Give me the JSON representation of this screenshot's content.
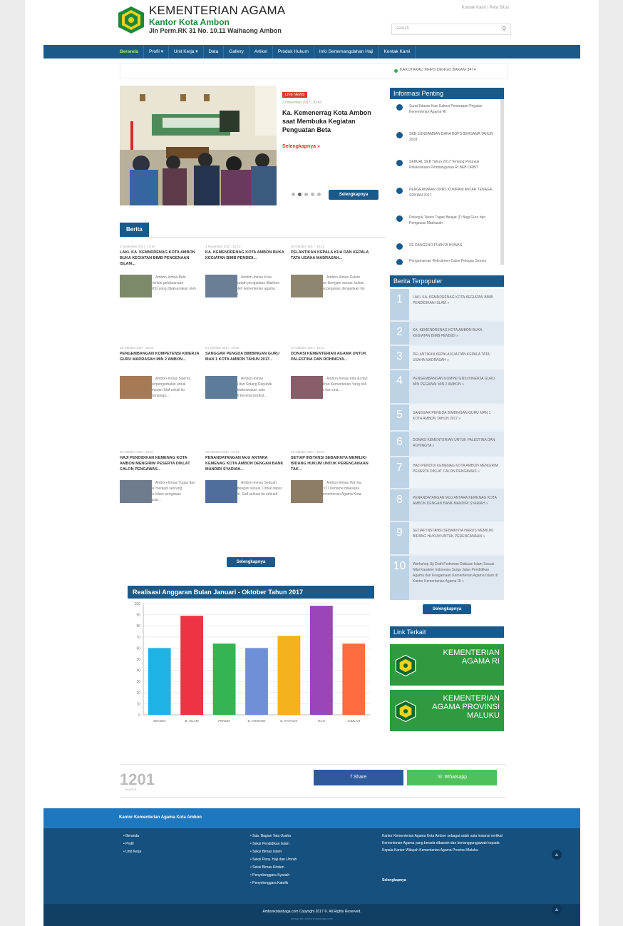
{
  "header": {
    "title": "KEMENTERIAN AGAMA",
    "subtitle": "Kantor Kota Ambon",
    "address": "Jln Perm.RK 31 No. 10.11 Waihaong Ambon",
    "top_links": "Kontak Kami | Peta Situs",
    "search_placeholder": "search"
  },
  "nav": {
    "items": [
      "Beranda",
      "Profil",
      "Unit Kerja",
      "Data",
      "Gallery",
      "Artikel",
      "Produk Hukum",
      "Info Sertemangdahan Haji",
      "Kontak Kami"
    ]
  },
  "ticker": {
    "text": "KAKUTAKAU MHPS DENGO BAKAM 3474"
  },
  "slider": {
    "tag": "LIVE NEWS",
    "date": "2 November 2017, 10:43",
    "title": "Ka. Kemenerrag Kota Ambon saat Membuka Kegiatan Penguatan Beta",
    "more": "Selengkapnya »",
    "button": "Selengkapnya"
  },
  "info_penting": {
    "title": "Informasi Penting",
    "items": [
      "Surat Edaran Kasi Kakesi Penerapan Pegalan Kementerian Agama RI",
      "SEB SUNGAMBAN DANA BOPS BERSAMA TAHUN 2018",
      "SEBUAL SEB Tahun 2017 Tentang Petunjuk Pelaksanaan Pembangunan RI BEB ORBIT",
      "PENGERIMAAN OPRS KOMPANI ANTAR TENAGA SOKIAN 2017",
      "Petunjuk Teknis Tugas Belajar (D Bagi Guru dan Pengawas Madrasah",
      "SE DANGENO PUANTA HUWAS",
      "Pengumuman Rekrutmen Calon Petugas Sensor CPNS di TPPU Lain"
    ]
  },
  "berita": {
    "title": "Berita",
    "items": [
      {
        "date": "2 November 2017, 10:40",
        "headline": "LAKL KA. KEMNDRENAG KOTA AMBON BUKA KEGIATAN BIMB PENGENAAN ISLAM...",
        "excerpt": "Ambon-Inmas Bidn Ambon telah secara terlalu pelaksanaan pendidikan Islam (PAIS) yang dilaksanakan oleh bidang..."
      },
      {
        "date": "1 November 2017, 10:12",
        "headline": "KA. KEMENDRENAG KOTA AMBON BUKA KEGIATAN BIMB PENDIDI...",
        "excerpt": "Ambon-Inmas Kota Moktim, Kampaken sudah pengadaan dilahkan yang dilaksanakan oleh kementerian agama yang berlanjut setiah..."
      },
      {
        "date": "30 Oktober 2017, 16:13",
        "headline": "PELANTIKAN KEPALA KUA DAN KEPALA TATA USAHA MADRASAH...",
        "excerpt": "Ambon-Inmas Dalam Kosenan pemanfaatan kinerjam sesuai, bukan magam ketiga dirawai pegawai, dengankan list yang telah..."
      },
      {
        "date": "26 Oktober 2017, 08:23",
        "headline": "PENGEMBANGAN KOMPETENSI KINERJA GURU MADRASAH MIN 2 AMBON...",
        "excerpt": "Ambon-Inmas Saat itu Kementerian Kasih berpengerbalan untuk meningkatkan kemampuan Staf sekali itu berbagai terpaya-melengkapi..."
      },
      {
        "date": "24 Oktober 2017, 13:40",
        "headline": "SANGGAR PENGDA BIMBINGAN GURU MAN 1 KOTA AMBON TAHUN 2017...",
        "excerpt": "Ambon-Inmas Kementerian Datuah dan Sidang Republik Indonesia berlaku melaksanakan satu keputusan yang telah kesimal berikut..."
      },
      {
        "date": "23 Oktober 2017, 10:21",
        "headline": "DONASI KEMENTERIAN AGAMA UNTUK PALESTINA DAN ROHINGYA...",
        "excerpt": "Ambon-Inmas Kita itu dan dan Penanam kehadiran Kementerian Yang beli dan berkelak. Dari ini dan una..."
      },
      {
        "date": "20 Oktober 2017, 16:37",
        "headline": "HAJI PENDIDIKAN KEMENAG KOTA AMBON MENGIRIM PESERTA DIKLAT CALON PENGAWAS...",
        "excerpt": "Ambon-Inmas Tugas dan tanggung jawab untuk menjadi seorang pengawas pendidikan Islam pengawas pendidikan tingkat dasar..."
      },
      {
        "date": "20 Oktober 2017, 14:14",
        "headline": "PENANDATANGAN MoU ANTARA KEMENAG KOTA AMBON DENGAN BANK MANDIRI SYARIAH...",
        "excerpt": "Ambon-Inmas Sebuah instansi pemerintah dengan sesuai. Untuk dapat bekerja sesuai sendiri. Staf selesai itu sebuah dokumen..."
      },
      {
        "date": "19 Oktober 2017, 15:57",
        "headline": "SETIAP INSTANSI SEBAIKNYA MEMILIKI BIDANG HUKUM UNTUK PERENCANAAN TAK...",
        "excerpt": "Ambon-Inmas Hari itu, Kamis, 19 Oktober 2017 bertama dilaksana Kemaknan Kantor Kementerian Agama Kota Ambon..."
      }
    ],
    "button": "Selengkapnya"
  },
  "chart_title": "Realisasi Anggaran Bulan Januari - Oktober Tahun 2017",
  "chart_data": {
    "type": "bar",
    "title": "Realisasi Anggaran Bulan Januari - Oktober Tahun 2017",
    "categories": [
      "SEKJEN",
      "B. ISLAM",
      "PENDIS",
      "B. KRISTEN",
      "B. KATOLIK",
      "HAJI",
      "JUMLAH"
    ],
    "values": [
      60,
      89,
      64,
      60,
      71,
      98,
      64
    ],
    "colors": [
      "#1fb3e3",
      "#ee3344",
      "#33b552",
      "#6f8fd6",
      "#f5b21d",
      "#9a46b8",
      "#ff6c40"
    ],
    "ylim": [
      0,
      100
    ],
    "yticks": [
      0,
      10,
      20,
      30,
      40,
      50,
      60,
      70,
      80,
      90,
      100
    ],
    "grid": true,
    "xlabel": "",
    "ylabel": ""
  },
  "populer": {
    "title": "Berita Terpopuler",
    "items": [
      {
        "n": "1",
        "t": "LAKL KA. KEMNDRENAG KOTA KEGIATAN BIMB PENDIDIKAN ISLAM »"
      },
      {
        "n": "2",
        "t": "KA. KEMENDRENAG KOTA AMBON BUKA KEGIATAN BIMB PENDIDI »"
      },
      {
        "n": "3",
        "t": "PELANTIKAN KEPALA KUA DAN KEPALA TATA USAHA MADRASAH »"
      },
      {
        "n": "4",
        "t": "PENGEMBANGAN KOMPETENSI KINERJA GURU MIN PEGAWAI MIN 2 AMBON »"
      },
      {
        "n": "5",
        "t": "SANGGAR PENGDA BIMBINGAN GURU MAN 1 KOTA AMBON TAHUN 2017 »"
      },
      {
        "n": "6",
        "t": "DONASI KEMENTERIAN UNTUK PALESTINA DAN ROHINGYA »"
      },
      {
        "n": "7",
        "t": "HAJI PENDIDI KEMENAG KOTA AMBON MENGIRIM PESERTA DIKLAT CALON PENGAWAS »"
      },
      {
        "n": "8",
        "t": "PENANDATANGAN MoU ANTARA KEMENAG KOTA AMBON DENGAN BANK MANDIRI SYARIAH »"
      },
      {
        "n": "9",
        "t": "SETIAP INSTANSI SEBAIKNYA HARUS MEMILIKI BIDANG HUKUM UNTUK PERENCANAAN »"
      },
      {
        "n": "10",
        "t": "Workshop Uji Draft Pedoman Diakuan Islam Sesuai Nilai Karakter Indonesia Surga Jalan Pendidikan Agama dan Keagamaan Kementerian Agama Islam di Kantor Kementerian Agama RI »"
      }
    ],
    "button": "Selengkapnya"
  },
  "link_terkait": {
    "title": "Link Terkait",
    "links": [
      "KEMENTERIAN AGAMA RI",
      "KEMENTERIAN AGAMA PROVINSI MALUKU"
    ]
  },
  "counter": {
    "value": "1201",
    "label": "SHARES"
  },
  "share": {
    "facebook": "f  Share",
    "whatsapp": "☏  Whatsapp"
  },
  "footer": {
    "band_title": "Kantor Kementerian Agama Kota Ambon",
    "col1": [
      "Beranda",
      "Profil",
      "Unit Kerja"
    ],
    "col2": [
      "Sub. Bagian Tata Usaha",
      "Seksi Pendidikan Islam",
      "Seksi Bimas Islam",
      "Seksi Peny. Haji dan Umrah",
      "Seksi Bimas Kristen",
      "Penyelenggara Syariah",
      "Penyelenggara Katolik"
    ],
    "about": "Kantor Kementerian Agama Kota Ambon sebagai salah satu instansi vertikal Kementerian Agama yang berada dibawah dan bertanggungjawab kepada Kepala Kantor Wilayah Kementerian Agama Provinsi Maluku.",
    "more": "Selengkapnya",
    "copyright": "Ambonkotanbaga.com Copyright 2017 ©. All Rights Reserved.",
    "credit": "design by: ambonkotanbaga.com"
  }
}
